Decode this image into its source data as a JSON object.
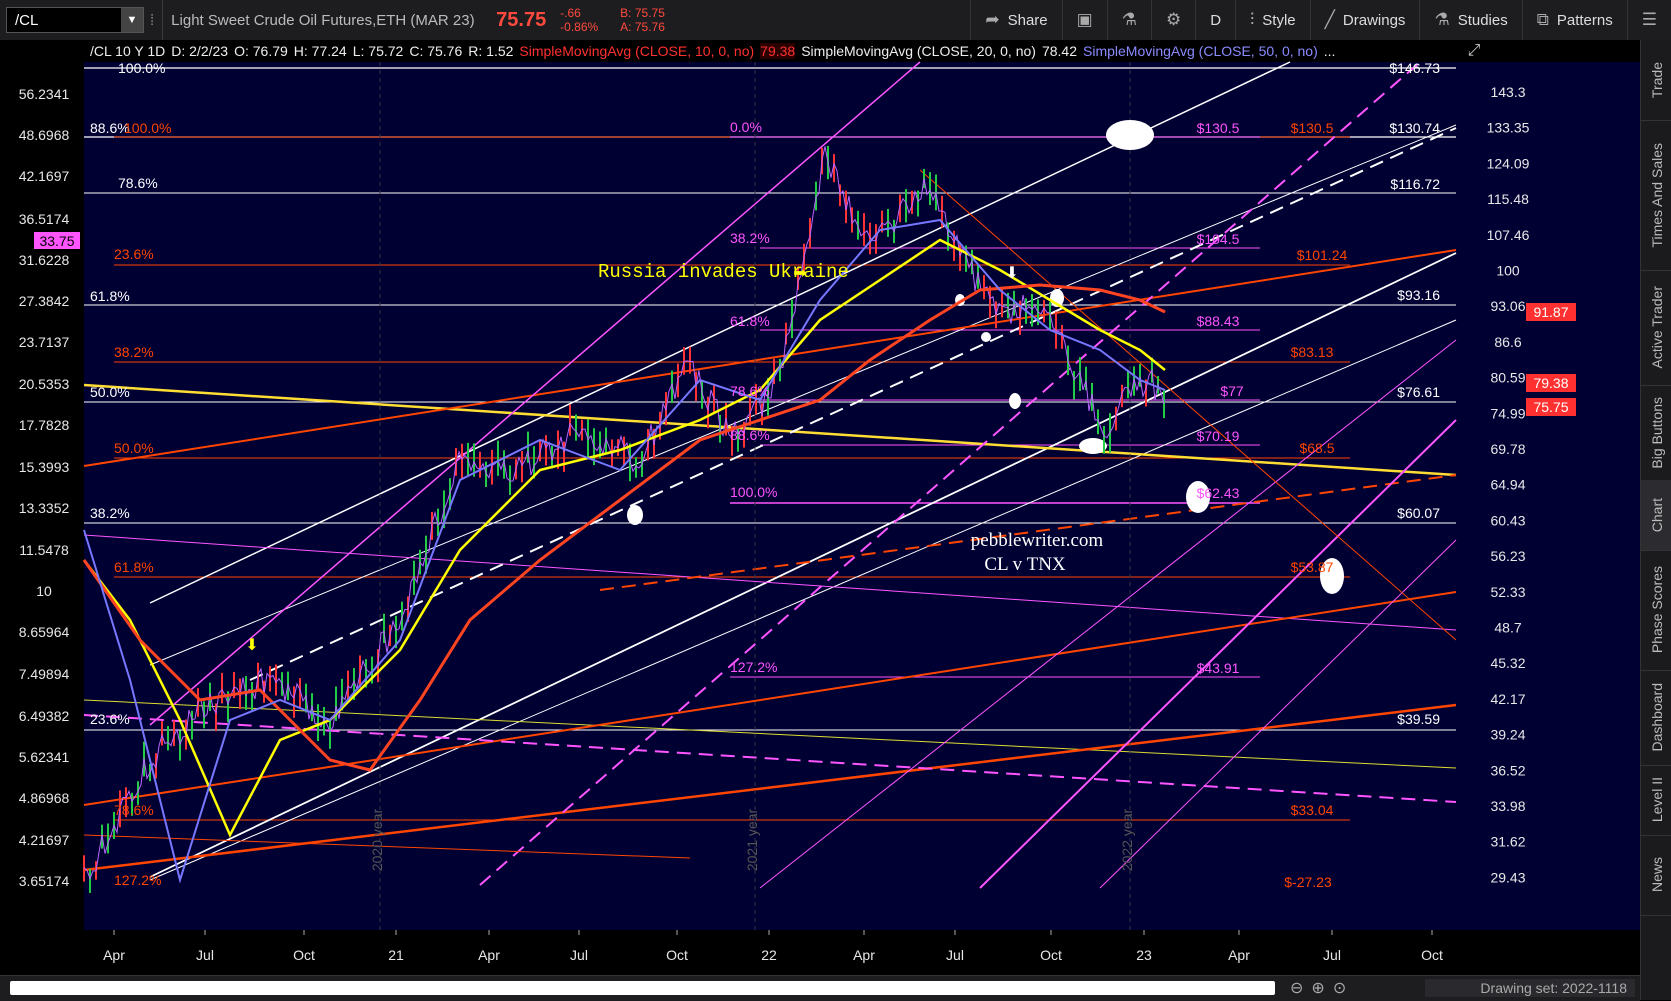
{
  "toolbar": {
    "symbol": "/CL",
    "title": "Light Sweet Crude Oil Futures,ETH (MAR 23)",
    "last": "75.75",
    "change": "-.66",
    "change_pct": "-0.86%",
    "bid": "B: 75.75",
    "ask": "A: 75.76",
    "share": "Share",
    "period": "D",
    "style": "Style",
    "drawings": "Drawings",
    "studies": "Studies",
    "patterns": "Patterns"
  },
  "study_line": {
    "symbol": "/CL 10 Y 1D",
    "date": "D: 2/2/23",
    "open": "O: 76.79",
    "high": "H: 77.24",
    "low": "L: 75.72",
    "close": "C: 75.76",
    "range": "R: 1.52",
    "sma10": "SimpleMovingAvg (CLOSE, 10, 0, no)",
    "sma10_val": "79.38",
    "sma20": "SimpleMovingAvg (CLOSE, 20, 0, no)",
    "sma20_val": "78.42",
    "sma50": "SimpleMovingAvg (CLOSE, 50, 0, no)",
    "more": "..."
  },
  "right_axis": [
    "143.3",
    "133.35",
    "124.09",
    "115.48",
    "107.46",
    "100",
    "93.06",
    "86.6",
    "80.59",
    "74.99",
    "69.78",
    "64.94",
    "60.43",
    "56.23",
    "52.33",
    "48.7",
    "45.32",
    "42.17",
    "39.24",
    "36.52",
    "33.98",
    "31.62",
    "29.43"
  ],
  "left_axis": [
    "56.2341",
    "48.6968",
    "42.1697",
    "36.5174",
    "33.75",
    "31.6228",
    "27.3842",
    "23.7137",
    "20.5353",
    "17.7828",
    "15.3993",
    "13.3352",
    "11.5478",
    "10",
    "8.65964",
    "7.49894",
    "6.49382",
    "5.62341",
    "4.86968",
    "4.21697",
    "3.65174"
  ],
  "price_tags": {
    "sma50": "91.87",
    "sma10": "79.38",
    "last": "75.75"
  },
  "x_axis": [
    "Apr",
    "Jul",
    "Oct",
    "21",
    "Apr",
    "Jul",
    "Oct",
    "22",
    "Apr",
    "Jul",
    "Oct",
    "23",
    "Apr",
    "Jul",
    "Oct"
  ],
  "year_labels": [
    "2020 year",
    "2021 year",
    "2022 year"
  ],
  "fib_left": {
    "p100": "100.0%",
    "p886": "88.6%",
    "p786": "78.6%",
    "p618a": "61.8%",
    "p500": "50.0%",
    "p382": "38.2%",
    "r100": "100.0%",
    "r236": "23.6%",
    "r382": "38.2%",
    "r500": "50.0%",
    "r618": "61.8%",
    "r236b": "23.6%",
    "r786": "78.6%",
    "r1272": "127.2%"
  },
  "fib_mid": {
    "f0": "0.0%",
    "f382": "38.2%",
    "f618": "61.8%",
    "f786": "78.6%",
    "f886": "88.6%",
    "f100": "100.0%",
    "f1272": "127.2%"
  },
  "targets": {
    "t14673": "$146.73",
    "t13074": "$130.74",
    "t11672": "$116.72",
    "t9316": "$93.16",
    "t7661": "$76.61",
    "t6007": "$60.07",
    "t3959": "$39.59",
    "m1305": "$130.5",
    "m1045": "$104.5",
    "m8843": "$88.43",
    "m77": "$77",
    "m7019": "$70.19",
    "m6243": "$62.43",
    "m4391": "$43.91",
    "o1305": "$130.5",
    "o10124": "$101.24",
    "o8313": "$83.13",
    "o685": "$68.5",
    "o5387": "$53.87",
    "o3304": "$33.04",
    "o2723": "$-27.23"
  },
  "annotations": {
    "russia": "Russia invades Ukraine",
    "site": "pebblewriter.com",
    "pair": "CL v TNX"
  },
  "sidebar": [
    "Trade",
    "Times And Sales",
    "Active Trader",
    "Big Buttons",
    "Chart",
    "Phase Scores",
    "Dashboard",
    "Level II",
    "News"
  ],
  "bottom": {
    "drawing_set": "Drawing set: 2022-1118"
  },
  "colors": {
    "bg": "#000033",
    "white": "#ffffff",
    "magenta": "#ff55ff",
    "orange": "#ff4500",
    "yellow": "#ffff00",
    "red": "#ff3030"
  }
}
